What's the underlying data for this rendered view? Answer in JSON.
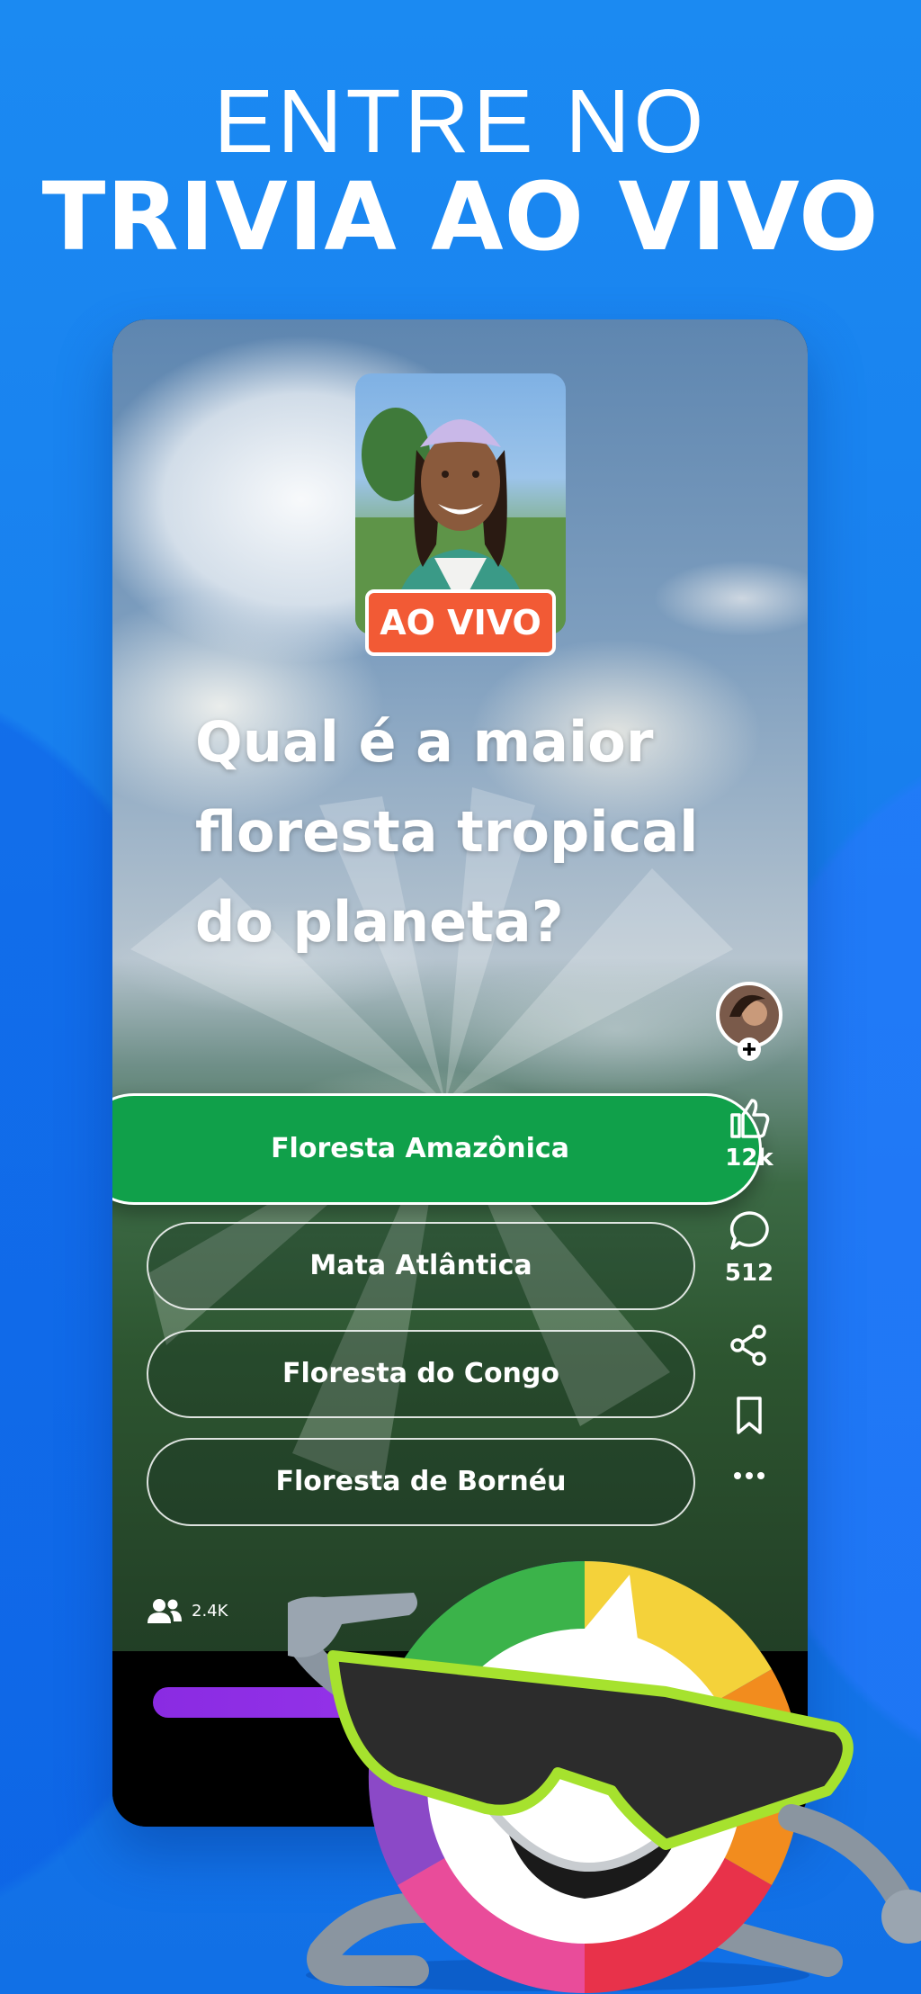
{
  "headline": {
    "line1": "ENTRE NO",
    "line2": "TRIVIA AO VIVO"
  },
  "live_badge": "AO VIVO",
  "question": "Qual é a maior floresta tropical do planeta?",
  "options": [
    {
      "label": "Floresta Amazônica",
      "state": "correct"
    },
    {
      "label": "Mata Atlântica",
      "state": "default"
    },
    {
      "label": "Floresta do Congo",
      "state": "default"
    },
    {
      "label": "Floresta de Bornéu",
      "state": "default"
    }
  ],
  "side_actions": {
    "likes": "12k",
    "comments": "512"
  },
  "viewers": "2.4K",
  "colors": {
    "background": "#1a7ff0",
    "correct": "#10a04a",
    "live": "#f25a35",
    "progress": "#8a2be2"
  },
  "icons": [
    "profile-avatar",
    "plus-icon",
    "thumbs-up-icon",
    "comment-icon",
    "share-icon",
    "bookmark-icon",
    "more-icon",
    "people-icon"
  ]
}
